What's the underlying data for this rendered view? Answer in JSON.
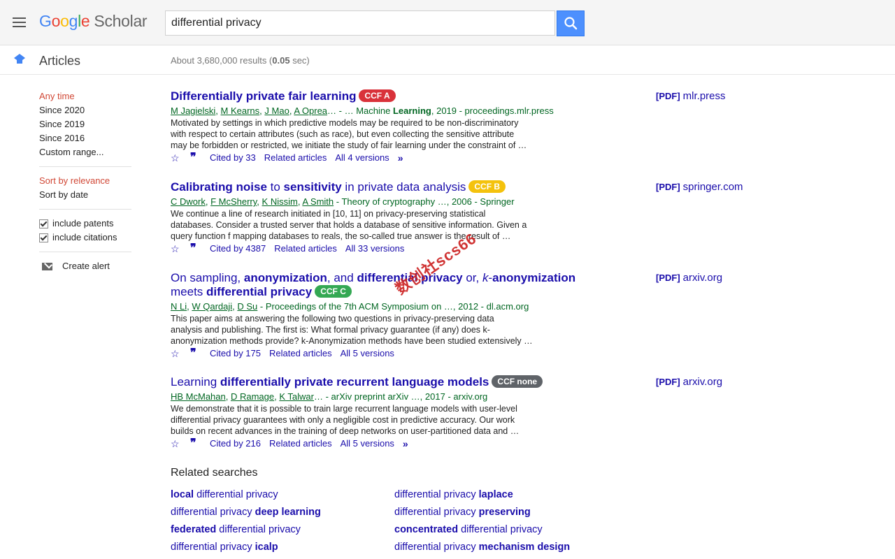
{
  "header": {
    "logo_letters": [
      "G",
      "o",
      "o",
      "g",
      "l",
      "e"
    ],
    "logo_suffix": "Scholar",
    "search_value": "differential privacy"
  },
  "subbar": {
    "section": "Articles",
    "results_prefix": "About 3,680,000 results (",
    "results_time": "0.05",
    "results_suffix": " sec)"
  },
  "sidebar": {
    "time_filters": [
      "Any time",
      "Since 2020",
      "Since 2019",
      "Since 2016",
      "Custom range..."
    ],
    "sort_options": [
      "Sort by relevance",
      "Sort by date"
    ],
    "checks": [
      "include patents",
      "include citations"
    ],
    "alert": "Create alert"
  },
  "results": [
    {
      "badge": "CCF A",
      "badge_color": "#d9323a",
      "authors": [
        {
          "t": "M Jagielski",
          "u": true
        },
        {
          "t": ", ",
          "u": false
        },
        {
          "t": "M Kearns",
          "u": true
        },
        {
          "t": ", ",
          "u": false
        },
        {
          "t": "J Mao",
          "u": true
        },
        {
          "t": ", ",
          "u": false
        },
        {
          "t": "A Oprea",
          "u": true
        },
        {
          "t": "… - … Machine ",
          "u": false
        },
        {
          "t": "Learning",
          "b": true
        },
        {
          "t": ", 2019 - proceedings.mlr.press",
          "u": false
        }
      ],
      "snippet_lines": [
        "Motivated by settings in which predictive models may be required to be non-discriminatory",
        "with respect to certain attributes (such as race), but even collecting the sensitive attribute",
        "may be forbidden or restricted, we initiate the study of fair learning under the constraint of …"
      ],
      "cited": "Cited by 33",
      "related": "Related articles",
      "versions": "All 4 versions",
      "more": true,
      "pdf_tag": "[PDF]",
      "pdf_domain": "mlr.press"
    },
    {
      "badge": "CCF B",
      "badge_color": "#f4c20d",
      "authors": [
        {
          "t": "C Dwork",
          "u": true
        },
        {
          "t": ", ",
          "u": false
        },
        {
          "t": "F McSherry",
          "u": true
        },
        {
          "t": ", ",
          "u": false
        },
        {
          "t": "K Nissim",
          "u": true
        },
        {
          "t": ", ",
          "u": false
        },
        {
          "t": "A Smith",
          "u": true
        },
        {
          "t": " - Theory of cryptography …, 2006 - Springer",
          "u": false
        }
      ],
      "snippet_lines": [
        "We continue a line of research initiated in [10, 11] on privacy-preserving statistical",
        "databases. Consider a trusted server that holds a database of sensitive information. Given a",
        "query function f mapping databases to reals, the so-called true answer is the result of …"
      ],
      "cited": "Cited by 4387",
      "related": "Related articles",
      "versions": "All 33 versions",
      "more": false,
      "pdf_tag": "[PDF]",
      "pdf_domain": "springer.com"
    },
    {
      "badge": "CCF C",
      "badge_color": "#34a853",
      "authors": [
        {
          "t": "N Li",
          "u": true
        },
        {
          "t": ", ",
          "u": false
        },
        {
          "t": "W Qardaji",
          "u": true
        },
        {
          "t": ", ",
          "u": false
        },
        {
          "t": "D Su",
          "u": true
        },
        {
          "t": " - Proceedings of the 7th ACM Symposium on …, 2012 - dl.acm.org",
          "u": false
        }
      ],
      "snippet_lines": [
        "This paper aims at answering the following two questions in privacy-preserving data",
        "analysis and publishing. The first is: What formal privacy guarantee (if any) does k-",
        "anonymization methods provide? k-Anonymization methods have been studied extensively …"
      ],
      "cited": "Cited by 175",
      "related": "Related articles",
      "versions": "All 5 versions",
      "more": false,
      "pdf_tag": "[PDF]",
      "pdf_domain": "arxiv.org"
    },
    {
      "badge": "CCF none",
      "badge_color": "#5f6368",
      "authors": [
        {
          "t": "HB McMahan",
          "u": true
        },
        {
          "t": ", ",
          "u": false
        },
        {
          "t": "D Ramage",
          "u": true
        },
        {
          "t": ", ",
          "u": false
        },
        {
          "t": "K Talwar",
          "u": true
        },
        {
          "t": "… - arXiv preprint arXiv …, 2017 - arxiv.org",
          "u": false
        }
      ],
      "snippet_lines": [
        "We demonstrate that it is possible to train large recurrent language models with user-level",
        "differential privacy guarantees with only a negligible cost in predictive accuracy. Our work",
        "builds on recent advances in the training of deep networks on user-partitioned data and …"
      ],
      "cited": "Cited by 216",
      "related": "Related articles",
      "versions": "All 5 versions",
      "more": true,
      "pdf_tag": "[PDF]",
      "pdf_domain": "arxiv.org"
    }
  ],
  "titles": {
    "r0": [
      {
        "t": "Differentially private fair learning",
        "b": true
      }
    ],
    "r1": [
      {
        "t": "Calibrating noise",
        "b": true
      },
      {
        "t": " to ",
        "b": false
      },
      {
        "t": "sensitivity",
        "b": true
      },
      {
        "t": " in private data analysis",
        "b": false
      }
    ],
    "r2a": [
      {
        "t": "On sampling, ",
        "b": false
      },
      {
        "t": "anonymization",
        "b": true
      },
      {
        "t": ", and ",
        "b": false
      },
      {
        "t": "differential privacy",
        "b": true
      },
      {
        "t": " or, ",
        "b": false
      },
      {
        "t": "k",
        "i": true
      },
      {
        "t": "-",
        "b": false
      },
      {
        "t": "anonymization",
        "b": true
      }
    ],
    "r2b": [
      {
        "t": "meets ",
        "b": false
      },
      {
        "t": "differential privacy",
        "b": true
      }
    ],
    "r3": [
      {
        "t": "Learning ",
        "b": false
      },
      {
        "t": "differentially private recurrent language models",
        "b": true
      }
    ]
  },
  "related": {
    "heading": "Related searches",
    "items": [
      [
        {
          "t": "local",
          "b": true
        },
        {
          "t": " differential privacy",
          "b": false
        }
      ],
      [
        {
          "t": "differential privacy ",
          "b": false
        },
        {
          "t": "laplace",
          "b": true
        }
      ],
      [
        {
          "t": "differential privacy ",
          "b": false
        },
        {
          "t": "deep learning",
          "b": true
        }
      ],
      [
        {
          "t": "differential privacy ",
          "b": false
        },
        {
          "t": "preserving",
          "b": true
        }
      ],
      [
        {
          "t": "federated",
          "b": true
        },
        {
          "t": " differential privacy",
          "b": false
        }
      ],
      [
        {
          "t": "concentrated",
          "b": true
        },
        {
          "t": " differential privacy",
          "b": false
        }
      ],
      [
        {
          "t": "differential privacy ",
          "b": false
        },
        {
          "t": "icalp",
          "b": true
        }
      ],
      [
        {
          "t": "differential privacy ",
          "b": false
        },
        {
          "t": "mechanism design",
          "b": true
        }
      ]
    ]
  },
  "watermark": "数创社scs66"
}
